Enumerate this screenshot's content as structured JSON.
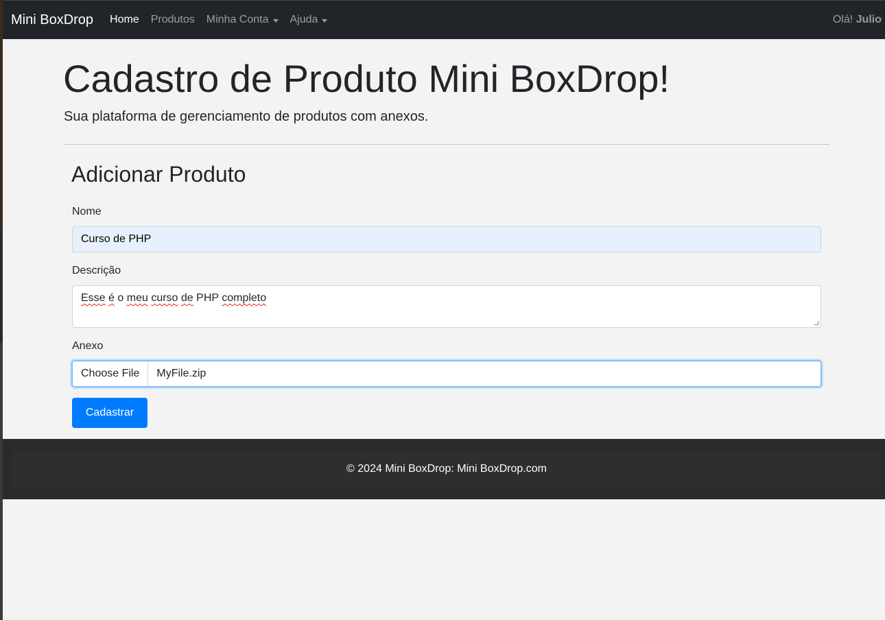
{
  "navbar": {
    "brand": "Mini BoxDrop",
    "items": [
      {
        "label": "Home",
        "active": true,
        "dropdown": false
      },
      {
        "label": "Produtos",
        "active": false,
        "dropdown": false
      },
      {
        "label": "Minha Conta",
        "active": false,
        "dropdown": true
      },
      {
        "label": "Ajuda",
        "active": false,
        "dropdown": true
      }
    ],
    "greeting_prefix": "Olá!",
    "user_name": "Julio"
  },
  "hero": {
    "title": "Cadastro de Produto Mini BoxDrop!",
    "lead": "Sua plataforma de gerenciamento de produtos com anexos."
  },
  "form": {
    "title": "Adicionar Produto",
    "name_label": "Nome",
    "name_value": "Curso de PHP",
    "description_label": "Descrição",
    "description_words": [
      "Esse",
      "é",
      "o",
      "meu",
      "curso",
      "de",
      "PHP",
      "completo"
    ],
    "attachment_label": "Anexo",
    "file_button_label": "Choose File",
    "file_name": "MyFile.zip",
    "submit_label": "Cadastrar"
  },
  "footer": {
    "text": "© 2024 Mini BoxDrop: Mini BoxDrop.com"
  },
  "colors": {
    "navbar_bg": "#212529",
    "primary": "#007bff",
    "page_bg": "#f3f3f3",
    "footer_bg": "#2b2b2b"
  }
}
